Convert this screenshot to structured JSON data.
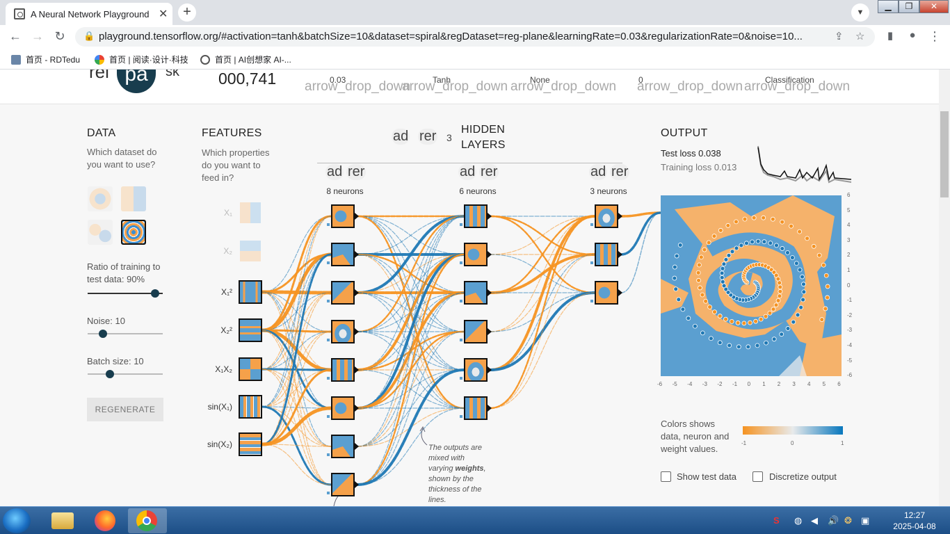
{
  "browser": {
    "tab_title": "A Neural Network Playground",
    "tab_close": "✕",
    "new_tab": "+",
    "url": "playground.tensorflow.org/#activation=tanh&batchSize=10&dataset=spiral&regDataset=reg-plane&learningRate=0.03&regularizationRate=0&noise=10...",
    "bookmarks": [
      "首页 - RDTedu",
      "首页 | 阅读·设计·科技",
      "首页 | AI创想家 AI-..."
    ],
    "win_controls": [
      "▁",
      "❐",
      "✕"
    ]
  },
  "header": {
    "logo_left": "rei",
    "logo_center": "pa",
    "logo_right": "sk",
    "epoch": "000,741",
    "dropdowns": [
      {
        "value": "0.03",
        "icon_text": "arrow_drop_down"
      },
      {
        "value": "Tanh",
        "icon_text": "arrow_drop_down"
      },
      {
        "value": "None",
        "icon_text": "arrow_drop_down"
      },
      {
        "value": "0",
        "icon_text": "arrow_drop_down"
      },
      {
        "value": "Classification",
        "icon_text": "arrow_drop_down"
      }
    ]
  },
  "data_panel": {
    "title": "DATA",
    "question": "Which dataset do you want to use?",
    "ratio_label": "Ratio of training to test data:  90%",
    "noise_label": "Noise:  10",
    "batch_label": "Batch size:  10",
    "ratio": 0.9,
    "noise": 0.2,
    "batch": 0.3,
    "regenerate": "REGENERATE"
  },
  "features_panel": {
    "title": "FEATURES",
    "question": "Which properties do you want to feed in?",
    "features": [
      {
        "label": "X₁",
        "enabled": false
      },
      {
        "label": "X₂",
        "enabled": false
      },
      {
        "label": "X₁²",
        "enabled": true
      },
      {
        "label": "X₂²",
        "enabled": true
      },
      {
        "label": "X₁X₂",
        "enabled": true
      },
      {
        "label": "sin(X₁)",
        "enabled": true
      },
      {
        "label": "sin(X₂)",
        "enabled": true
      }
    ]
  },
  "network": {
    "add_icon": "ad",
    "remove_icon": "rer",
    "hidden_layers_count": "3",
    "hidden_layers_label_1": "HIDDEN",
    "hidden_layers_label_2": "LAYERS",
    "layers": [
      {
        "neurons_label": "8 neurons",
        "count": 8
      },
      {
        "neurons_label": "6 neurons",
        "count": 6
      },
      {
        "neurons_label": "3 neurons",
        "count": 3
      }
    ],
    "annotation_1": "The outputs are",
    "annotation_2": "mixed with",
    "annotation_3a": "varying ",
    "annotation_3b": "weights",
    "annotation_3c": ",",
    "annotation_4": "shown by the",
    "annotation_5": "thickness of the",
    "annotation_6": "lines."
  },
  "output_panel": {
    "title": "OUTPUT",
    "test_loss": "Test loss 0.038",
    "training_loss": "Training loss 0.013",
    "x_ticks": [
      "-6",
      "-5",
      "-4",
      "-3",
      "-2",
      "-1",
      "0",
      "1",
      "2",
      "3",
      "4",
      "5",
      "6"
    ],
    "y_ticks": [
      "6",
      "5",
      "4",
      "3",
      "2",
      "1",
      "0",
      "-1",
      "-2",
      "-3",
      "-4",
      "-5",
      "-6"
    ],
    "legend_text_1": "Colors shows",
    "legend_text_2": "data, neuron and",
    "legend_text_3": "weight values.",
    "legend_min": "-1",
    "legend_mid": "0",
    "legend_max": "1",
    "show_test_data": "Show test data",
    "discretize_output": "Discretize output",
    "colors": {
      "positive": "#1f78b4",
      "negative": "#f59322"
    }
  },
  "taskbar": {
    "time": "12:27",
    "date": "2025-04-08"
  }
}
